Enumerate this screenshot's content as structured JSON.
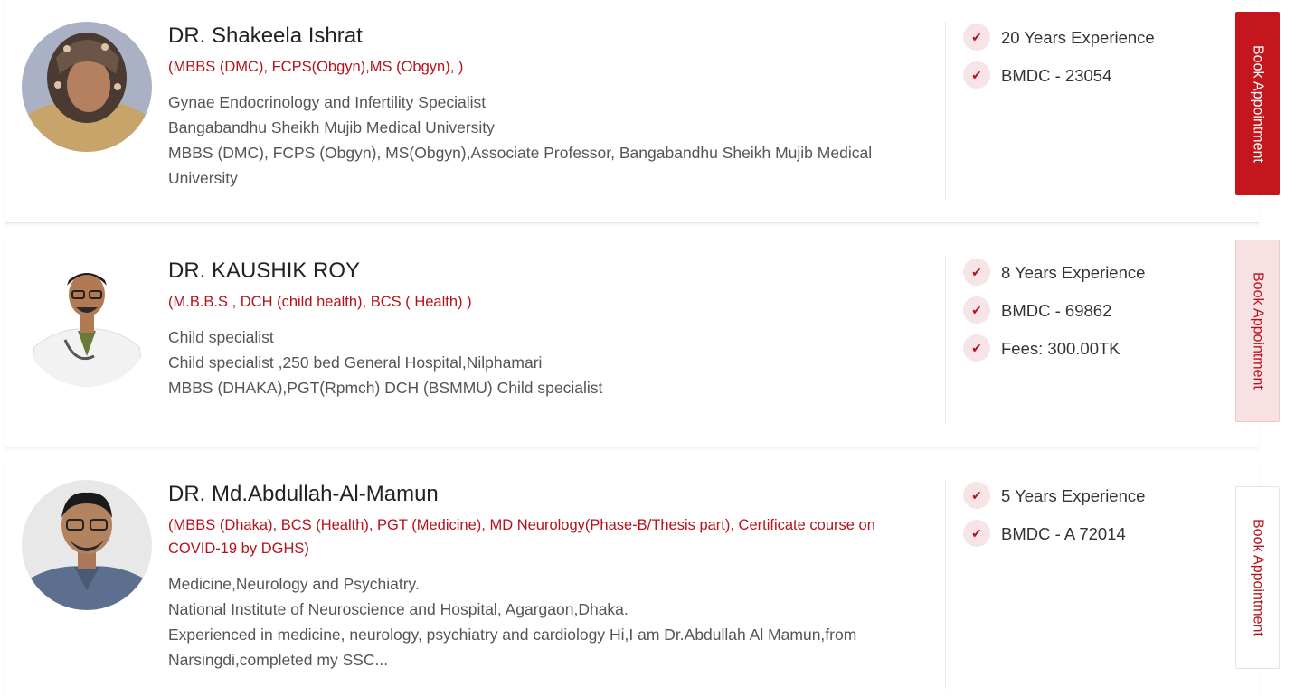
{
  "colors": {
    "accent": "#c4161c",
    "accent_soft": "#f8e1e3",
    "check_bg": "#f7e4e6"
  },
  "doctors": [
    {
      "name": "DR. Shakeela Ishrat",
      "qualifications": "(MBBS (DMC), FCPS(Obgyn),MS (Obgyn), )",
      "description": [
        "Gynae Endocrinology and Infertility Specialist",
        "Bangabandhu Sheikh Mujib Medical University",
        "MBBS (DMC), FCPS (Obgyn), MS(Obgyn),Associate Professor, Bangabandhu Sheikh Mujib Medical University"
      ],
      "facts": [
        "20 Years Experience",
        "BMDC - 23054"
      ],
      "book_label": "Book Appointment"
    },
    {
      "name": "DR. KAUSHIK ROY",
      "qualifications": "(M.B.B.S , DCH (child health), BCS ( Health) )",
      "description": [
        "Child specialist",
        "Child specialist ,250 bed General Hospital,Nilphamari",
        "MBBS (DHAKA),PGT(Rpmch) DCH (BSMMU) Child specialist"
      ],
      "facts": [
        "8 Years Experience",
        "BMDC - 69862",
        "Fees: 300.00TK"
      ],
      "book_label": "Book Appointment"
    },
    {
      "name": "DR. Md.Abdullah-Al-Mamun",
      "qualifications": "(MBBS (Dhaka), BCS (Health), PGT (Medicine), MD Neurology(Phase-B/Thesis part), Certificate course on COVID-19 by DGHS)",
      "description": [
        "Medicine,Neurology and Psychiatry.",
        "National Institute of Neuroscience and Hospital, Agargaon,Dhaka.",
        "Experienced in medicine, neurology, psychiatry and cardiology Hi,I am Dr.Abdullah Al Mamun,from Narsingdi,completed my SSC..."
      ],
      "facts": [
        "5 Years Experience",
        "BMDC - A 72014"
      ],
      "book_label": "Book Appointment"
    }
  ]
}
